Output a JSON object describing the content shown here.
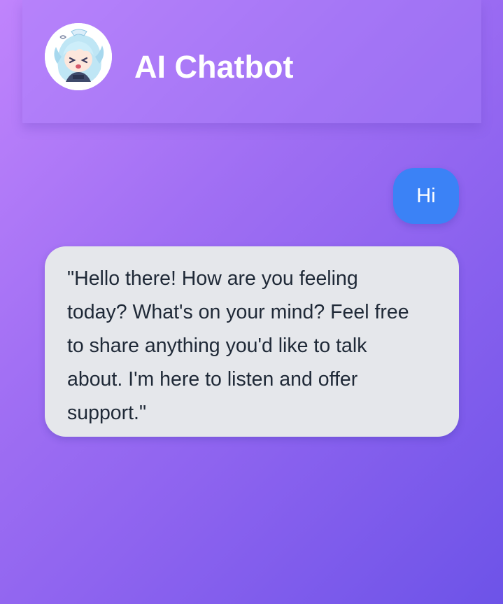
{
  "header": {
    "title": "AI Chatbot",
    "avatar_icon": "anime-character-avatar"
  },
  "messages": [
    {
      "role": "user",
      "text": "Hi"
    },
    {
      "role": "bot",
      "text": "\"Hello there! How are you feeling today? What's on your mind? Feel free to share anything you'd like to talk about. I'm here to listen and offer support.\""
    }
  ],
  "colors": {
    "background_start": "#c084fc",
    "background_end": "#6d53e8",
    "user_bubble": "#3b82f6",
    "bot_bubble": "#e5e7eb",
    "bot_text": "#1f2937",
    "title_text": "#ffffff"
  }
}
